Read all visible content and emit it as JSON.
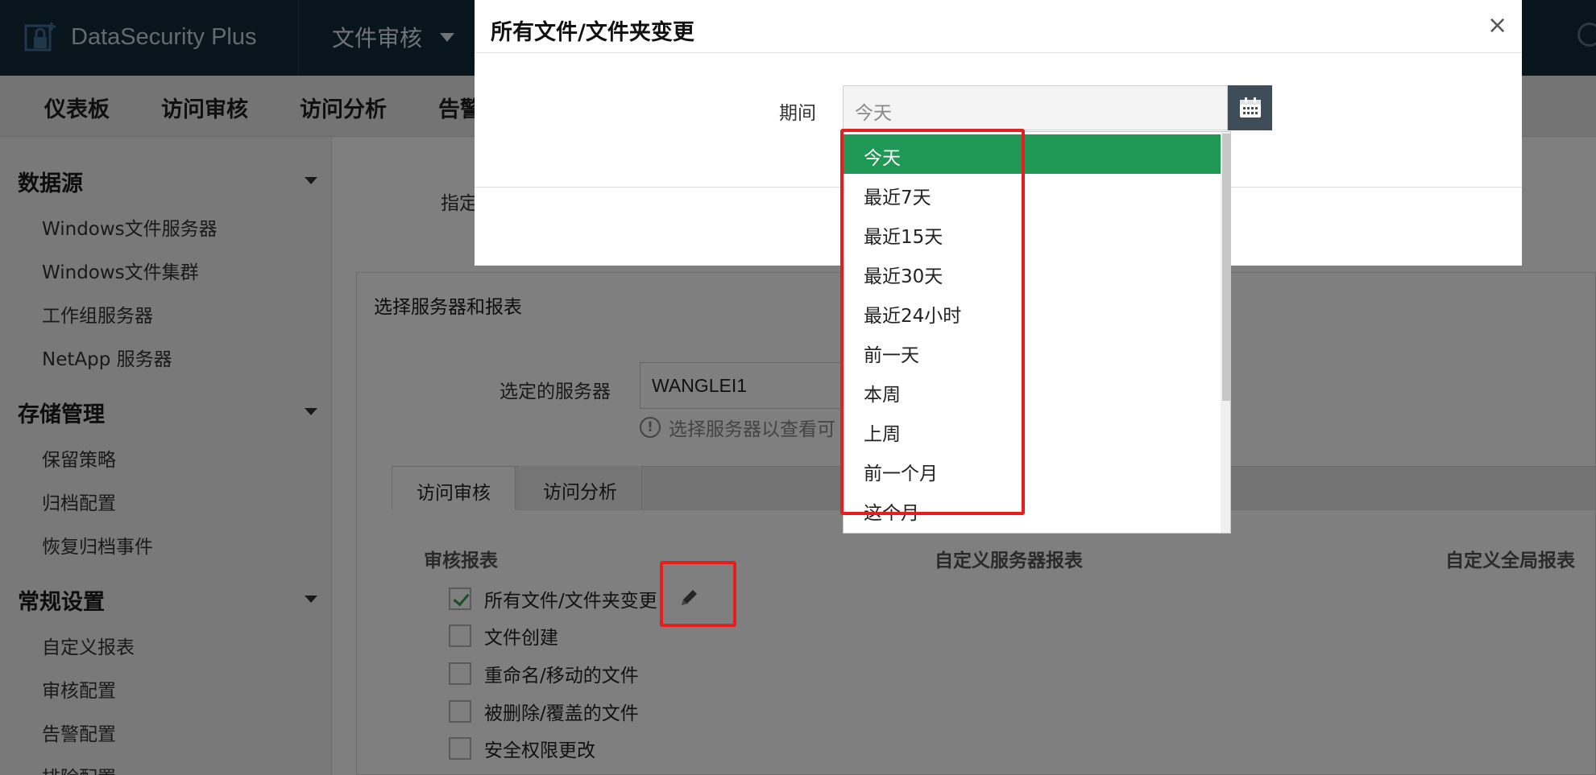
{
  "app": {
    "brand": "DataSecurity Plus",
    "module": "文件审核"
  },
  "nav": {
    "items": [
      "仪表板",
      "访问审核",
      "访问分析",
      "告警"
    ]
  },
  "sidebar": {
    "sections": [
      {
        "title": "数据源",
        "items": [
          "Windows文件服务器",
          "Windows文件集群",
          "工作组服务器",
          "NetApp 服务器"
        ]
      },
      {
        "title": "存储管理",
        "items": [
          "保留策略",
          "归档配置",
          "恢复归档事件"
        ]
      },
      {
        "title": "常规设置",
        "items": [
          "自定义报表",
          "审核配置",
          "告警配置",
          "排除配置"
        ]
      }
    ]
  },
  "main": {
    "specify_label": "指定",
    "panel_title": "选择服务器和报表",
    "server_label": "选定的服务器",
    "server_value": "WANGLEI1",
    "server_hint": "选择服务器以查看可",
    "tabs": [
      "访问审核",
      "访问分析"
    ],
    "columns": [
      "审核报表",
      "自定义服务器报表",
      "自定义全局报表"
    ],
    "reports": [
      {
        "label": "所有文件/文件夹变更",
        "checked": true
      },
      {
        "label": "文件创建",
        "checked": false
      },
      {
        "label": "重命名/移动的文件",
        "checked": false
      },
      {
        "label": "被删除/覆盖的文件",
        "checked": false
      },
      {
        "label": "安全权限更改",
        "checked": false
      }
    ]
  },
  "modal": {
    "title": "所有文件/文件夹变更",
    "close": "×",
    "period_label": "期间",
    "period_placeholder": "今天"
  },
  "dropdown": {
    "options": [
      "今天",
      "最近7天",
      "最近15天",
      "最近30天",
      "最近24小时",
      "前一天",
      "本周",
      "上周",
      "前一个月",
      "这个月"
    ],
    "selected_index": 0
  },
  "colors": {
    "topbar": "#122a3a",
    "selected": "#1f9855",
    "highlight": "#e61e1e",
    "calendar_btn": "#3e4d57"
  }
}
